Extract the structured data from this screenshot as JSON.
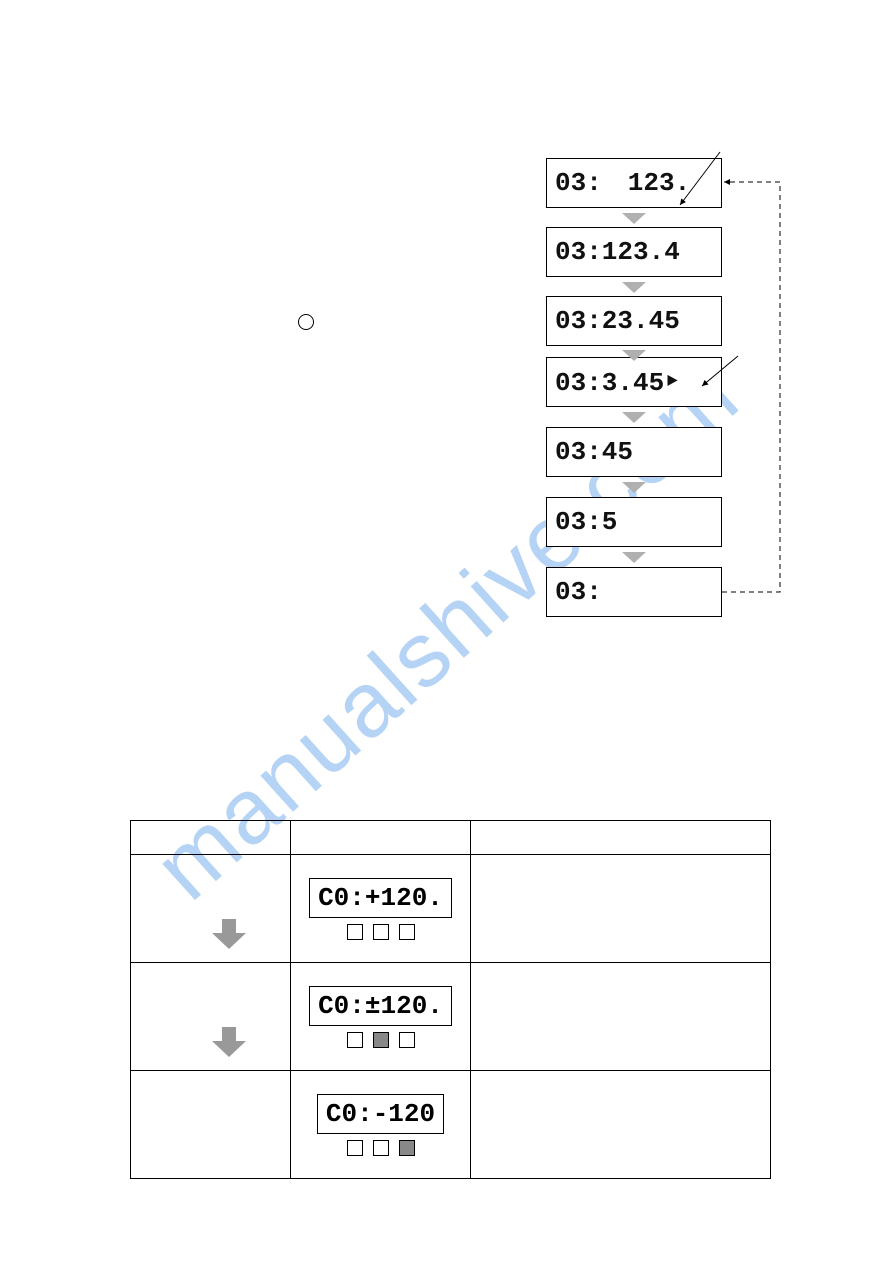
{
  "marker_circle": {},
  "right_stack": {
    "displays": [
      "03: 123.",
      "03:123.4",
      "03:23.45",
      "03:3.45‣",
      "03:45",
      "03:5",
      "03:"
    ]
  },
  "table": {
    "rows": [
      {
        "lcd": "C0:+120.",
        "squares": [
          "empty",
          "empty",
          "empty"
        ]
      },
      {
        "lcd": "C0:±120.",
        "squares": [
          "empty",
          "fill",
          "empty"
        ]
      },
      {
        "lcd": "C0:-120",
        "squares": [
          "empty",
          "empty",
          "fill"
        ]
      }
    ]
  },
  "watermark": "manualshive.com"
}
